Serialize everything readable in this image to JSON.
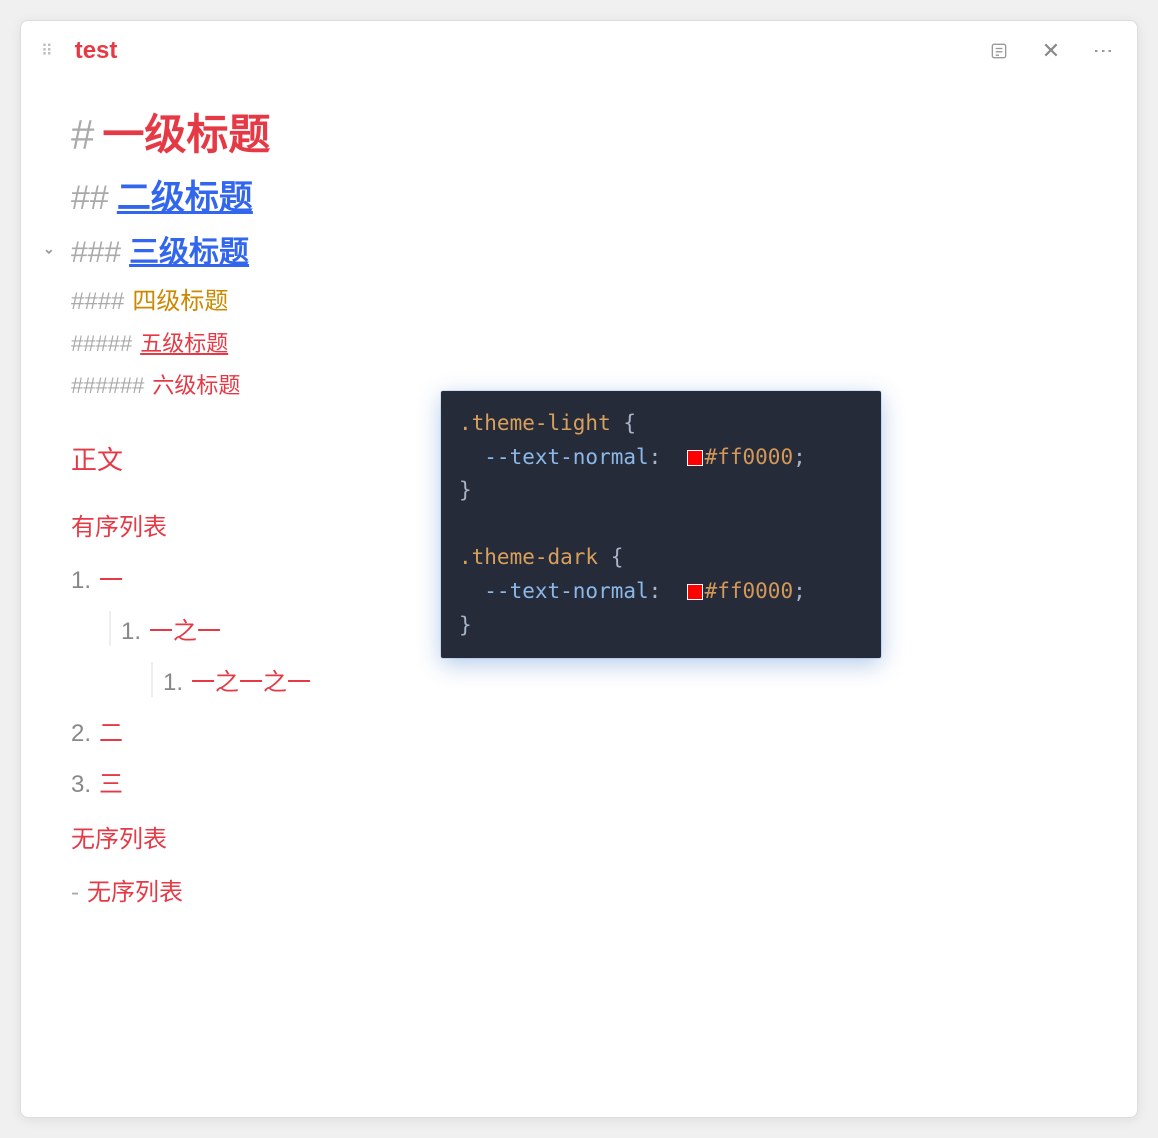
{
  "titlebar": {
    "title": "test"
  },
  "headings": {
    "h1": {
      "hash": "#",
      "text": "一级标题"
    },
    "h2": {
      "hash": "##",
      "text": "二级标题"
    },
    "h3": {
      "hash": "###",
      "text": "三级标题"
    },
    "h4": {
      "hash": "####",
      "text": "四级标题"
    },
    "h5": {
      "hash": "#####",
      "text": "五级标题"
    },
    "h6": {
      "hash": "######",
      "text": "六级标题"
    }
  },
  "body_text": "正文",
  "ordered": {
    "label": "有序列表",
    "items": {
      "i1": {
        "num": "1.",
        "text": "一"
      },
      "i1_1": {
        "num": "1.",
        "text": "一之一"
      },
      "i1_1_1": {
        "num": "1.",
        "text": "一之一之一"
      },
      "i2": {
        "num": "2.",
        "text": "二"
      },
      "i3": {
        "num": "3.",
        "text": "三"
      }
    }
  },
  "unordered": {
    "label": "无序列表",
    "items": {
      "i1": {
        "bullet": "-",
        "text": "无序列表"
      }
    }
  },
  "code": {
    "l1_sel": ".theme-light",
    "l1_ob": " {",
    "l2_prop": "  --text-normal",
    "l2_colon": ":  ",
    "l2_val": "#ff0000",
    "l2_semi": ";",
    "l3_cb": "}",
    "l4_sel": ".theme-dark",
    "l4_ob": " {",
    "l5_prop": "  --text-normal",
    "l5_colon": ":  ",
    "l5_val": "#ff0000",
    "l5_semi": ";",
    "l6_cb": "}",
    "swatch_color": "#ff0000"
  }
}
